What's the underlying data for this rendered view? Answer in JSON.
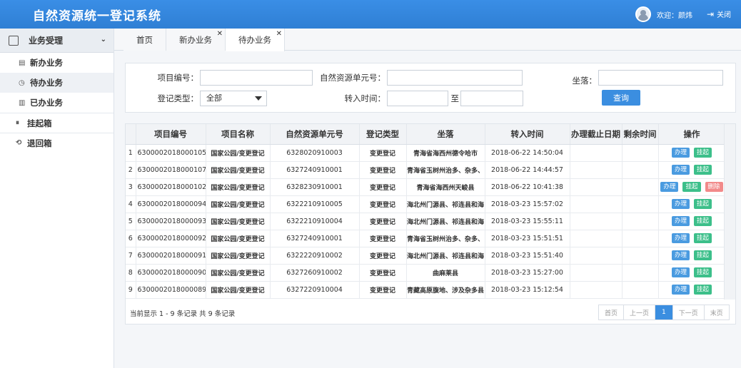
{
  "header": {
    "title": "自然资源统一登记系统",
    "welcome": "欢迎：颜炜",
    "logout": "关闭"
  },
  "sidebar": {
    "group_label": "业务受理",
    "items": [
      {
        "label": "新办业务",
        "icon": "new-doc-icon"
      },
      {
        "label": "待办业务",
        "icon": "clock-icon"
      },
      {
        "label": "已办业务",
        "icon": "doc-icon"
      },
      {
        "label": "挂起箱",
        "icon": "pause-icon"
      },
      {
        "label": "退回箱",
        "icon": "return-icon"
      }
    ]
  },
  "tabs": [
    {
      "label": "首页"
    },
    {
      "label": "新办业务"
    },
    {
      "label": "待办业务"
    }
  ],
  "filter": {
    "project_no_label": "项目编号：",
    "unit_no_label": "自然资源单元号：",
    "location_label": "坐落：",
    "reg_type_label": "登记类型：",
    "reg_type_value": "全部",
    "time_label": "转入时间：",
    "to_label": "至",
    "query_button": "查询"
  },
  "table": {
    "headers": [
      "",
      "项目编号",
      "项目名称",
      "自然资源单元号",
      "登记类型",
      "坐落",
      "转入时间",
      "办理截止日期",
      "剩余时间",
      "操作"
    ],
    "rows": [
      {
        "idx": "1",
        "project_no": "6300002018000105",
        "name": "国家公园/变更登记",
        "unit_no": "6328020910003",
        "type": "变更登记",
        "location": "青海省海西州德令哈市",
        "time": "2018-06-22 14:50:04"
      },
      {
        "idx": "2",
        "project_no": "6300002018000107",
        "name": "国家公园/变更登记",
        "unit_no": "6327240910001",
        "type": "变更登记",
        "location": "青海省玉树州治多、杂多、",
        "time": "2018-06-22 14:44:57"
      },
      {
        "idx": "3",
        "project_no": "6300002018000102",
        "name": "国家公园/变更登记",
        "unit_no": "6328230910001",
        "type": "变更登记",
        "location": "青海省海西州天峻县",
        "time": "2018-06-22 10:41:38"
      },
      {
        "idx": "4",
        "project_no": "6300002018000094",
        "name": "国家公园/变更登记",
        "unit_no": "6322210910005",
        "type": "变更登记",
        "location": "海北州门源县、祁连县和海",
        "time": "2018-03-23 15:57:02"
      },
      {
        "idx": "5",
        "project_no": "6300002018000093",
        "name": "国家公园/变更登记",
        "unit_no": "6322210910004",
        "type": "变更登记",
        "location": "海北州门源县、祁连县和海",
        "time": "2018-03-23 15:55:11"
      },
      {
        "idx": "6",
        "project_no": "6300002018000092",
        "name": "国家公园/变更登记",
        "unit_no": "6327240910001",
        "type": "变更登记",
        "location": "青海省玉树州治多、杂多、",
        "time": "2018-03-23 15:51:51"
      },
      {
        "idx": "7",
        "project_no": "6300002018000091",
        "name": "国家公园/变更登记",
        "unit_no": "6322220910002",
        "type": "变更登记",
        "location": "海北州门源县、祁连县和海",
        "time": "2018-03-23 15:51:40"
      },
      {
        "idx": "8",
        "project_no": "6300002018000090",
        "name": "国家公园/变更登记",
        "unit_no": "6327260910002",
        "type": "变更登记",
        "location": "曲麻莱县",
        "time": "2018-03-23 15:27:00"
      },
      {
        "idx": "9",
        "project_no": "6300002018000089",
        "name": "国家公园/变更登记",
        "unit_no": "6327220910004",
        "type": "变更登记",
        "location": "青藏高原腹地、涉及杂多县",
        "time": "2018-03-23 15:12:54"
      }
    ],
    "op_handle": "办理",
    "op_suspend": "挂起",
    "op_delete": "删除"
  },
  "pagination": {
    "info": "当前显示 1 - 9 条记录 共 9 条记录",
    "first": "首页",
    "prev": "上一页",
    "current": "1",
    "next": "下一页",
    "last": "末页"
  },
  "colors": {
    "header_blue": "#2f7fd4",
    "button_blue": "#3b8ee0",
    "op_green": "#3cbf8a",
    "op_red": "#f28a8a"
  }
}
